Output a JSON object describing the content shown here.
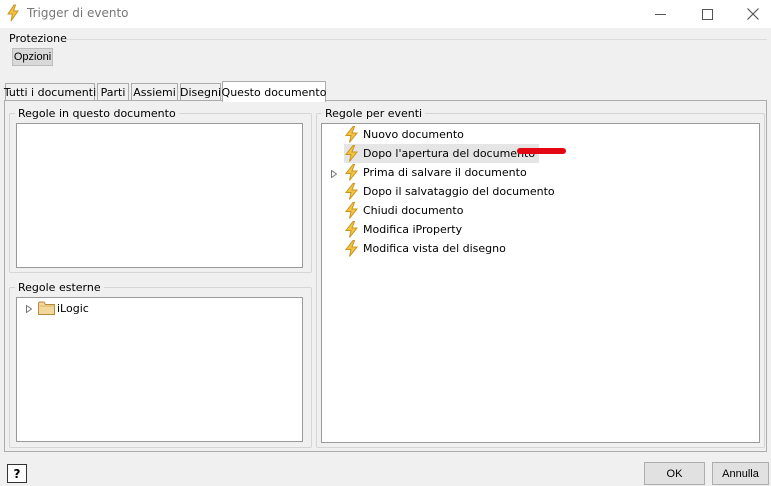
{
  "window": {
    "title": "Trigger di evento",
    "icon": "lightning-bolt-icon"
  },
  "protection": {
    "label": "Protezione",
    "options_button": "Opzioni"
  },
  "tabs": [
    {
      "label": "Tutti i documenti",
      "active": false
    },
    {
      "label": "Parti",
      "active": false
    },
    {
      "label": "Assiemi",
      "active": false
    },
    {
      "label": "Disegni",
      "active": false
    },
    {
      "label": "Questo documento",
      "active": true
    }
  ],
  "rules_in_document": {
    "legend": "Regole in questo documento",
    "items": []
  },
  "external_rules": {
    "legend": "Regole esterne",
    "items": [
      {
        "label": "iLogic",
        "icon": "folder-icon",
        "expandable": true
      }
    ]
  },
  "event_rules": {
    "legend": "Regole per eventi",
    "items": [
      {
        "label": "Nuovo documento",
        "icon": "lightning-bolt-icon",
        "expandable": false,
        "selected": false
      },
      {
        "label": "Dopo l'apertura del documento",
        "icon": "lightning-bolt-icon",
        "expandable": false,
        "selected": true
      },
      {
        "label": "Prima di salvare il documento",
        "icon": "lightning-bolt-icon",
        "expandable": true,
        "selected": false
      },
      {
        "label": "Dopo il salvataggio del documento",
        "icon": "lightning-bolt-icon",
        "expandable": false,
        "selected": false
      },
      {
        "label": "Chiudi documento",
        "icon": "lightning-bolt-icon",
        "expandable": false,
        "selected": false
      },
      {
        "label": "Modifica iProperty",
        "icon": "lightning-bolt-icon",
        "expandable": false,
        "selected": false
      },
      {
        "label": "Modifica vista del disegno",
        "icon": "lightning-bolt-icon",
        "expandable": false,
        "selected": false
      }
    ]
  },
  "footer": {
    "help_label": "?",
    "ok_label": "OK",
    "cancel_label": "Annulla"
  },
  "colors": {
    "bolt_fill": "#f5c242",
    "bolt_stroke": "#c8951c",
    "folder_fill": "#f3d89b",
    "highlight_mark": "#e30613"
  }
}
